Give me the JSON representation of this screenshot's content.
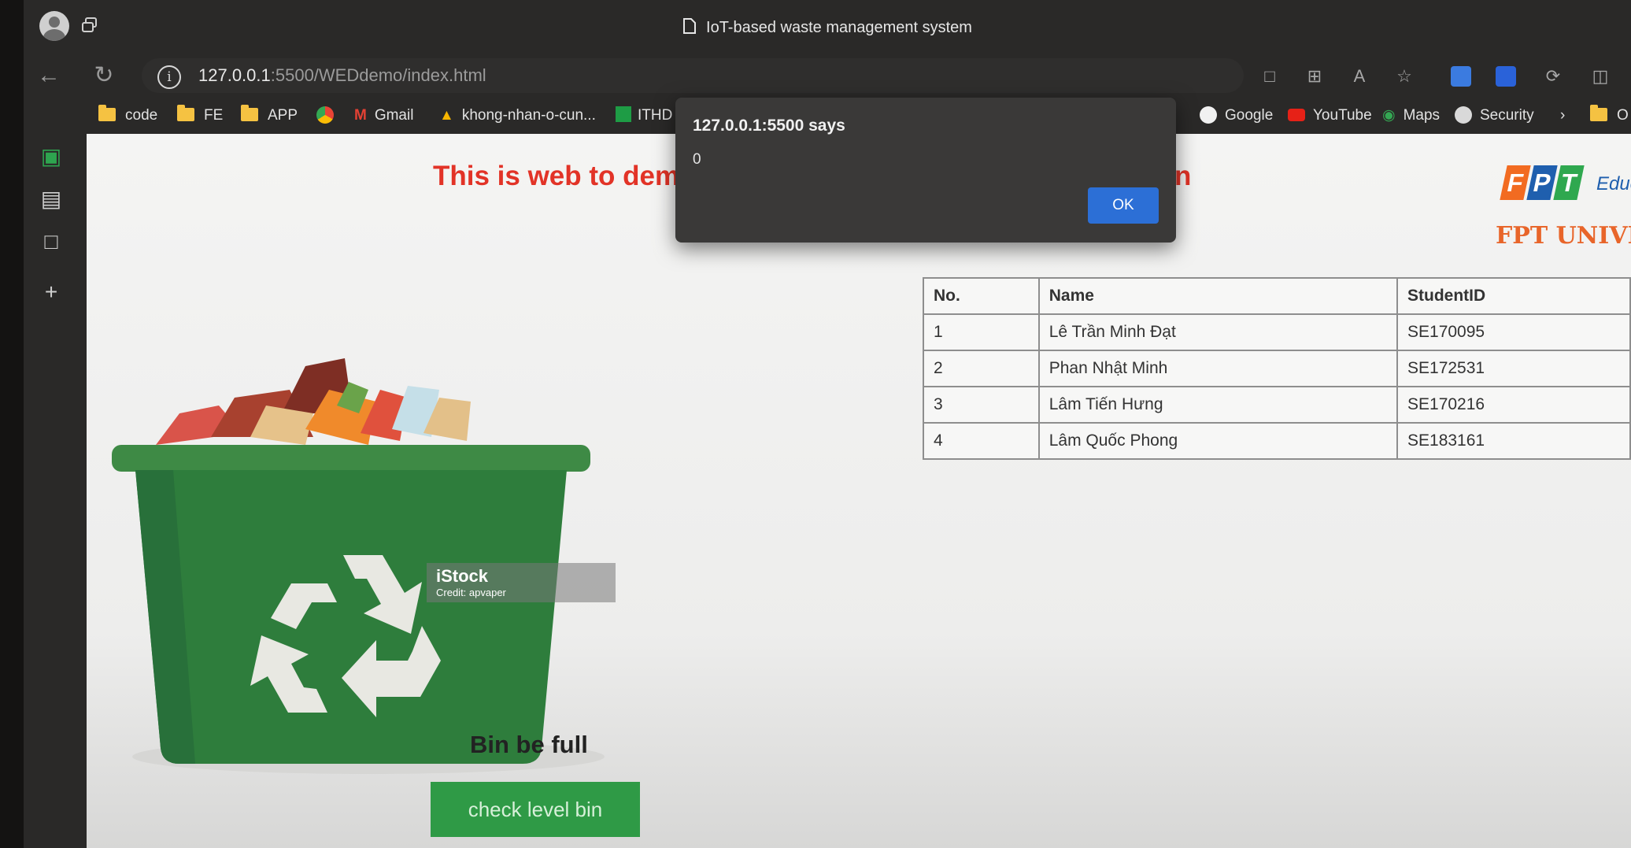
{
  "browser": {
    "tab_title": "IoT-based waste management system",
    "url_host": "127.0.0.1",
    "url_path": ":5500/WEDdemo/index.html",
    "bookmarks": [
      "code",
      "FE",
      "APP",
      "Gmail",
      "khong-nhan-o-cun...",
      "ITHD",
      "Google",
      "YouTube",
      "Maps",
      "Security",
      "O"
    ]
  },
  "page": {
    "heading_visible": "This is web to dem",
    "heading_tail": "n",
    "logo": {
      "edu": "Educa",
      "university": "FPT UNIVERS"
    },
    "table": {
      "headers": [
        "No.",
        "Name",
        "StudentID"
      ],
      "rows": [
        [
          "1",
          "Lê Trần Minh Đạt",
          "SE170095"
        ],
        [
          "2",
          "Phan Nhật Minh",
          "SE172531"
        ],
        [
          "3",
          "Lâm Tiến Hưng",
          "SE170216"
        ],
        [
          "4",
          "Lâm Quốc Phong",
          "SE183161"
        ]
      ]
    },
    "watermark": {
      "brand": "iStock",
      "credit": "Credit: apvaper"
    },
    "status_text": "Bin be full",
    "button_label": "check level bin"
  },
  "dialog": {
    "title": "127.0.0.1:5500 says",
    "message": "0",
    "ok_label": "OK"
  },
  "colors": {
    "heading": "#e23327",
    "button": "#2f9a46",
    "bin": "#2e7d3c",
    "dialog_ok": "#2c6fd6"
  }
}
